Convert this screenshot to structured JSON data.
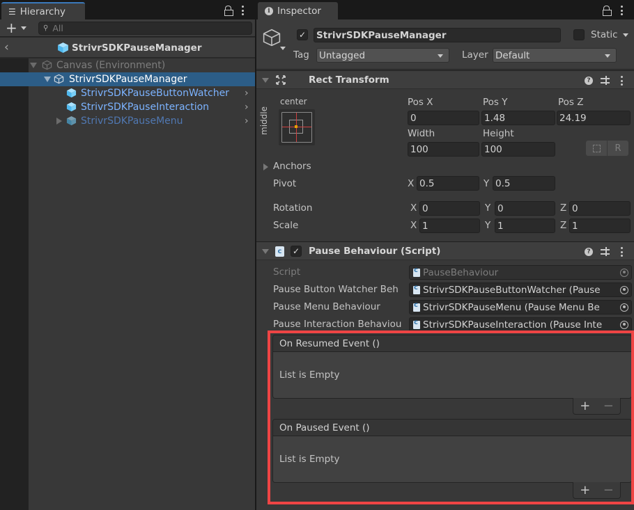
{
  "hierarchy": {
    "tab_label": "Hierarchy",
    "add_label": "+",
    "search_placeholder": "All",
    "breadcrumb_title": "StrivrSDKPauseManager",
    "items": [
      {
        "label": "Canvas (Environment)",
        "expanded": true,
        "color": "#7d7d7d"
      },
      {
        "label": "StrivrSDKPauseManager",
        "expanded": true,
        "selected": true,
        "color": "#ffffff"
      },
      {
        "label": "StrivrSDKPauseButtonWatcher",
        "color": "#7cb3ff"
      },
      {
        "label": "StrivrSDKPauseInteraction",
        "color": "#7cb3ff"
      },
      {
        "label": "StrivrSDKPauseMenu",
        "expanded": false,
        "color": "#5078b2"
      }
    ]
  },
  "inspector": {
    "tab_label": "Inspector",
    "object_name": "StrivrSDKPauseManager",
    "active": true,
    "static_label": "Static",
    "static_checked": false,
    "tag_label": "Tag",
    "tag_value": "Untagged",
    "layer_label": "Layer",
    "layer_value": "Default",
    "rect_transform": {
      "title": "Rect Transform",
      "anchor_h": "center",
      "anchor_v": "middle",
      "pos_x_label": "Pos X",
      "pos_x": "0",
      "pos_y_label": "Pos Y",
      "pos_y": "1.48",
      "pos_z_label": "Pos Z",
      "pos_z": "24.19",
      "width_label": "Width",
      "width": "100",
      "height_label": "Height",
      "height": "100",
      "raw_edit_label": "R",
      "anchors_label": "Anchors",
      "pivot_label": "Pivot",
      "pivot_x": "0.5",
      "pivot_y": "0.5",
      "rotation_label": "Rotation",
      "rot_x": "0",
      "rot_y": "0",
      "rot_z": "0",
      "scale_label": "Scale",
      "scale_x": "1",
      "scale_y": "1",
      "scale_z": "1",
      "axis_x": "X",
      "axis_y": "Y",
      "axis_z": "Z"
    },
    "pause_behaviour": {
      "title": "Pause Behaviour (Script)",
      "enabled": true,
      "fields": [
        {
          "label": "Script",
          "value": "PauseBehaviour",
          "disabled": true
        },
        {
          "label": "Pause Button Watcher Beh",
          "value": "StrivrSDKPauseButtonWatcher (Pause"
        },
        {
          "label": "Pause Menu Behaviour",
          "value": "StrivrSDKPauseMenu (Pause Menu Be"
        },
        {
          "label": "Pause Interaction Behaviou",
          "value": "StrivrSDKPauseInteraction (Pause Inte"
        }
      ],
      "events": [
        {
          "title": "On Resumed Event ()",
          "empty_text": "List is Empty",
          "add": "+",
          "remove": "−"
        },
        {
          "title": "On Paused Event ()",
          "empty_text": "List is Empty",
          "add": "+",
          "remove": "−"
        }
      ]
    }
  },
  "colors": {
    "selection": "#2c5d87",
    "highlight_border": "#ef4444",
    "prefab_blue": "#7cb3ff"
  }
}
